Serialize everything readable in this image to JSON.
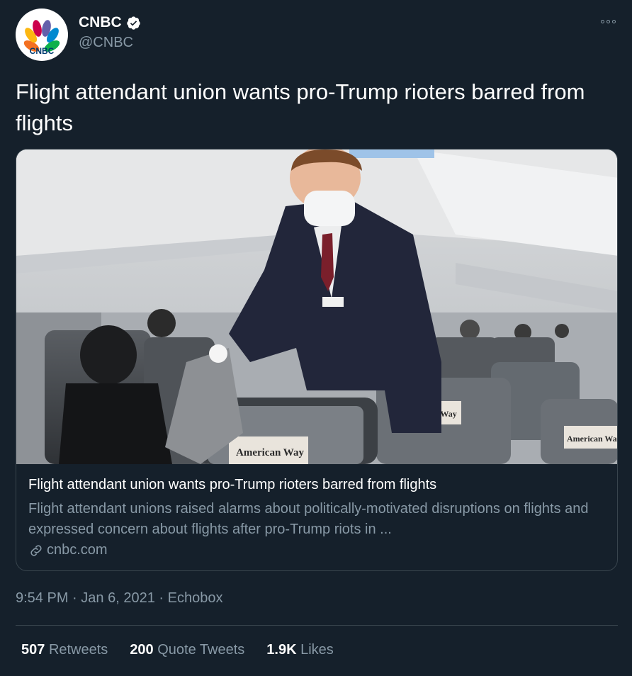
{
  "account": {
    "name": "CNBC",
    "handle": "@CNBC",
    "logo_text": "CNBC",
    "verified": true
  },
  "tweet": {
    "text": "Flight attendant union wants pro-Trump rioters barred from flights"
  },
  "card": {
    "image_signage": "American Way",
    "title": "Flight attendant union wants pro-Trump rioters barred from flights",
    "description": "Flight attendant unions raised alarms about politically-motivated disruptions on flights and expressed concern about flights after pro-Trump riots in ...",
    "domain": "cnbc.com"
  },
  "meta": {
    "time": "9:54 PM",
    "sep1": "·",
    "date": "Jan 6, 2021",
    "sep2": "·",
    "source": "Echobox"
  },
  "stats": [
    {
      "count": "507",
      "label": "Retweets"
    },
    {
      "count": "200",
      "label": "Quote Tweets"
    },
    {
      "count": "1.9K",
      "label": "Likes"
    }
  ],
  "colors": {
    "background": "#15202b",
    "text_primary": "#ffffff",
    "text_secondary": "#8899a6",
    "border": "#38444d"
  }
}
